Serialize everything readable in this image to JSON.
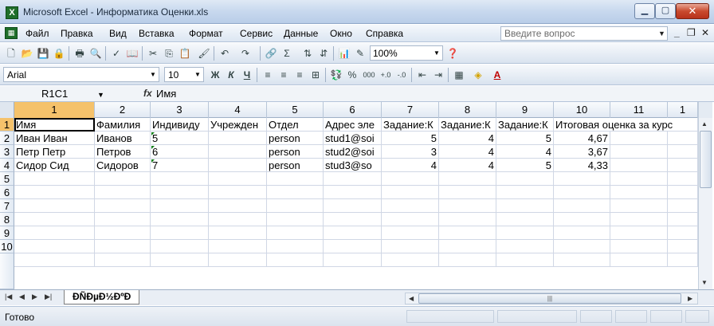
{
  "window": {
    "title": "Microsoft Excel - Информатика Оценки.xls"
  },
  "menu": {
    "items": [
      "Файл",
      "Правка",
      "Вид",
      "Вставка",
      "Формат",
      "Сервис",
      "Данные",
      "Окно",
      "Справка"
    ],
    "help_placeholder": "Введите вопрос"
  },
  "toolbar": {
    "zoom": "100%",
    "font": "Arial",
    "size": "10"
  },
  "formula_bar": {
    "name_box": "R1C1",
    "value": "Имя"
  },
  "columns": [
    "1",
    "2",
    "3",
    "4",
    "5",
    "6",
    "7",
    "8",
    "9",
    "10",
    "11",
    "1"
  ],
  "rows": [
    "1",
    "2",
    "3",
    "4",
    "5",
    "6",
    "7",
    "8",
    "9",
    "10"
  ],
  "cells": {
    "r1": [
      "Имя",
      "Фамилия",
      "Индивиду",
      "Учрежден",
      "Отдел",
      "Адрес эле",
      "Задание:К",
      "Задание:К",
      "Задание:К",
      "Итоговая оценка за курс"
    ],
    "r2": [
      "Иван Иван",
      "Иванов",
      "5",
      "",
      "person",
      "stud1@soi",
      "5",
      "4",
      "5",
      "4,67"
    ],
    "r3": [
      "Петр Петр",
      "Петров",
      "6",
      "",
      "person",
      "stud2@soi",
      "3",
      "4",
      "4",
      "3,67"
    ],
    "r4": [
      "Сидор Сид",
      "Сидоров",
      "7",
      "",
      "person",
      "stud3@so",
      "4",
      "4",
      "5",
      "4,33"
    ]
  },
  "sheet_tab": "ÐÑÐµÐ½ÐºÐ",
  "status": {
    "text": "Готово"
  },
  "colors": {
    "selected_header": "#f5c26b",
    "text_marker": "#0a7d16"
  }
}
